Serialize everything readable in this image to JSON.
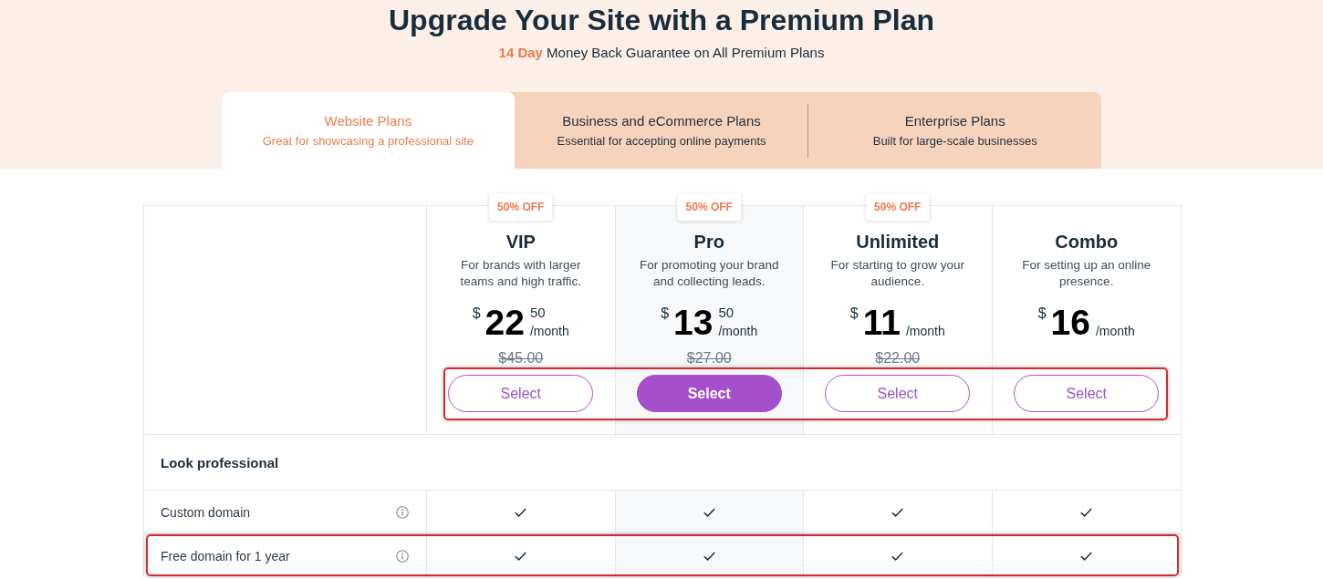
{
  "header": {
    "title": "Upgrade Your Site with a Premium Plan",
    "subtitle": "**14 Day** Money Back Guarantee on All Premium Plans"
  },
  "tabs": [
    {
      "label": "Website Plans",
      "caption": "Great for showcasing a professional site",
      "selected": true
    },
    {
      "label": "Business and eCommerce Plans",
      "caption": "Essential for accepting online payments",
      "selected": false
    },
    {
      "label": "Enterprise Plans",
      "caption": "Built for large-scale businesses",
      "selected": false
    }
  ],
  "plans": [
    {
      "badge": "50% OFF",
      "name": "VIP",
      "description": "For brands with larger teams and high traffic.",
      "currency": "$",
      "amount": "22",
      "cents": "50",
      "period": "/month",
      "original_price": "$45.00",
      "button": "Select",
      "featured": false
    },
    {
      "badge": "50% OFF",
      "name": "Pro",
      "description": "For promoting your brand and collecting leads.",
      "currency": "$",
      "amount": "13",
      "cents": "50",
      "period": "/month",
      "original_price": "$27.00",
      "button": "Select",
      "featured": true
    },
    {
      "badge": "50% OFF",
      "name": "Unlimited",
      "description": "For starting to grow your audience.",
      "currency": "$",
      "amount": "11",
      "period": "/month",
      "original_price": "$22.00",
      "button": "Select",
      "featured": false
    },
    {
      "name": "Combo",
      "description": "For setting up an online presence.",
      "currency": "$",
      "amount": "16",
      "period": "/month",
      "button": "Select",
      "featured": false
    }
  ],
  "select_buttons_highlighted": true,
  "sections": [
    {
      "title": "Look professional",
      "rows": [
        {
          "feature": "Custom domain",
          "info": true,
          "included": [
            true,
            true,
            true,
            true
          ],
          "highlighted": false
        },
        {
          "feature": "Free domain for 1 year",
          "info": true,
          "included": [
            true,
            true,
            true,
            true
          ],
          "highlighted": true
        }
      ]
    }
  ]
}
